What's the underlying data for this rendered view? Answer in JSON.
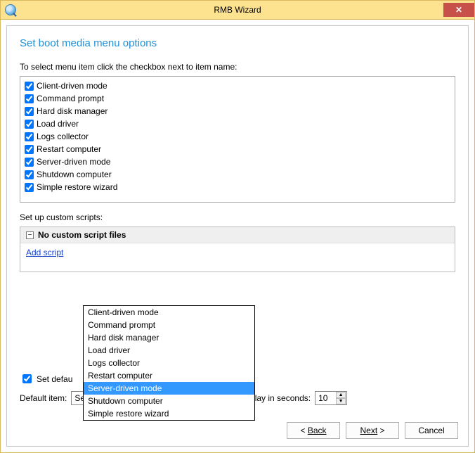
{
  "window": {
    "title": "RMB Wizard"
  },
  "heading": "Set boot media menu options",
  "instruction": "To select menu item click the checkbox next to item name:",
  "items": {
    "0": "Client-driven mode",
    "1": "Command prompt",
    "2": "Hard disk manager",
    "3": "Load driver",
    "4": "Logs collector",
    "5": "Restart computer",
    "6": "Server-driven mode",
    "7": "Shutdown computer",
    "8": "Simple restore wizard"
  },
  "scripts": {
    "label": "Set up custom scripts:",
    "header": "No custom script files",
    "addlink": "Add script"
  },
  "dropdown": {
    "0": "Client-driven mode",
    "1": "Command prompt",
    "2": "Hard disk manager",
    "3": "Load driver",
    "4": "Logs collector",
    "5": "Restart computer",
    "6": "Server-driven mode",
    "7": "Shutdown computer",
    "8": "Simple restore wizard",
    "selected": "Server-driven mode"
  },
  "defaults": {
    "set_label_visible": "Set defau",
    "default_item_label": "Default item:",
    "default_item_value": "Server-driven mode",
    "delay_label": "Delay in seconds:",
    "delay_value": "10"
  },
  "buttons": {
    "back": "Back",
    "next": "Next",
    "cancel": "Cancel"
  }
}
